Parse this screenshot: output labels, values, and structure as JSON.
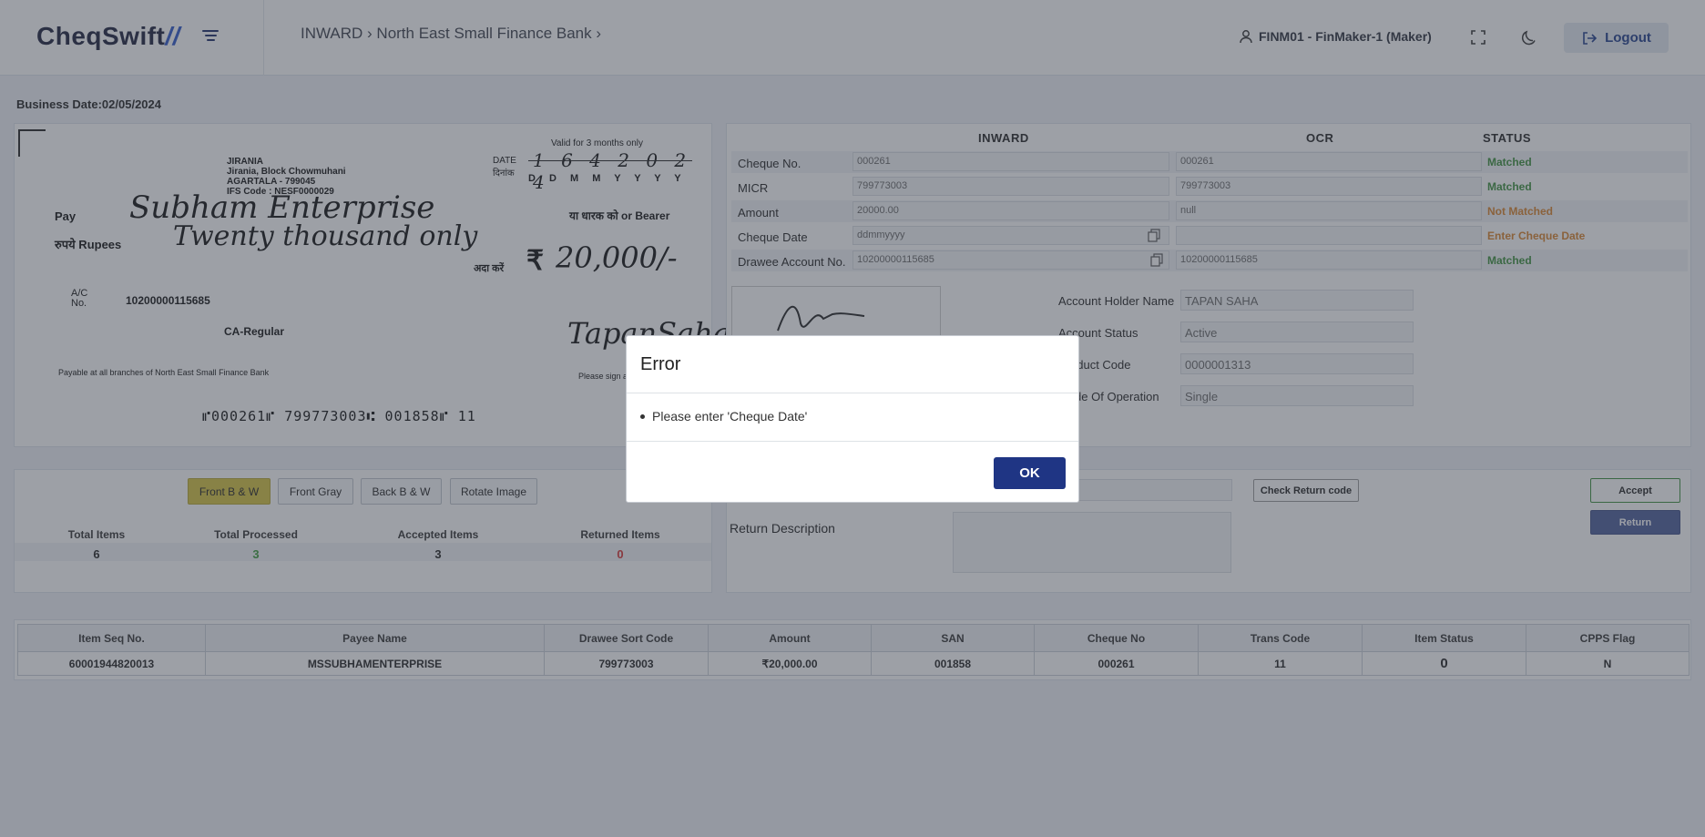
{
  "header": {
    "logo_text": "CheqSwift",
    "logo_slash": "//",
    "breadcrumb": "INWARD › North East Small Finance Bank ›",
    "user": "FINM01 - FinMaker-1 (Maker)",
    "logout_label": "Logout"
  },
  "business_date": "Business Date:02/05/2024",
  "cheque_image": {
    "valid_text": "Valid for 3 months only",
    "date_label": "DATE",
    "date_label_hi": "दिनांक",
    "date_handwritten": "1 6 4 2 0 2 4",
    "date_format": "D D M M Y Y Y Y",
    "drawer_name": "JIRANIA",
    "drawer_addr1": "Jirania, Block Chowmuhani",
    "drawer_addr2": "AGARTALA - 799045",
    "ifs_code": "IFS Code : NESF0000029",
    "pay_label": "Pay",
    "payee_hand": "Subham Enterprise",
    "or_bearer": "या धारक को or Bearer",
    "rupees_label": "रुपये Rupees",
    "amount_words_hand": "Twenty thousand only",
    "ada_kare": "अदा करें",
    "rupee_symbol": "₹",
    "amount_hand": "20,000/-",
    "ac_label": "A/C No.",
    "ac_no": "10200000115685",
    "ac_type": "CA-Regular",
    "sign_hand": "TapanSaha",
    "payable_text": "Payable at all branches of North East Small Finance Bank",
    "please_sign": "Please sign above",
    "micr_line": "⑈000261⑈ 799773003⑆ 001858⑈ 11"
  },
  "details": {
    "col_inward": "INWARD",
    "col_ocr": "OCR",
    "col_status": "STATUS",
    "rows": [
      {
        "label": "Cheque No.",
        "inward": "000261",
        "ocr": "000261",
        "status": "Matched"
      },
      {
        "label": "MICR",
        "inward": "799773003",
        "ocr": "799773003",
        "status": "Matched"
      },
      {
        "label": "Amount",
        "inward": "20000.00",
        "ocr": "null",
        "status": "Not Matched"
      },
      {
        "label": "Cheque Date",
        "inward": "ddmmyyyy",
        "ocr": "",
        "status": "Enter Cheque Date"
      },
      {
        "label": "Drawee Account No.",
        "inward": "10200000115685",
        "ocr": "10200000115685",
        "status": "Matched"
      }
    ],
    "status_colors": {
      "matched": "#3a8f3a",
      "warn": "#d9822b"
    },
    "account": {
      "holder_label": "Account Holder Name",
      "holder": "TAPAN SAHA",
      "status_label": "Account Status",
      "status": "Active",
      "product_label": "Product Code",
      "product": "0000001313",
      "mode_label": "Mode Of Operation",
      "mode": "Single"
    }
  },
  "image_buttons": [
    "Front B & W",
    "Front Gray",
    "Back B & W",
    "Rotate Image"
  ],
  "stats": {
    "total_items_label": "Total Items",
    "total_items": "6",
    "total_processed_label": "Total Processed",
    "total_processed": "3",
    "accepted_label": "Accepted Items",
    "accepted": "3",
    "returned_label": "Returned Items",
    "returned": "0"
  },
  "return_panel": {
    "check_return_code": "Check Return code",
    "accept": "Accept",
    "return": "Return",
    "return_description_label": "Return Description"
  },
  "table": {
    "headers": [
      "Item Seq No.",
      "Payee Name",
      "Drawee Sort Code",
      "Amount",
      "SAN",
      "Cheque No",
      "Trans Code",
      "Item Status",
      "CPPS Flag"
    ],
    "rows": [
      [
        "60001944820013",
        "MSSUBHAMENTERPRISE",
        "799773003",
        "₹20,000.00",
        "001858",
        "000261",
        "11",
        "0",
        "N"
      ]
    ]
  },
  "modal": {
    "title": "Error",
    "message": "Please enter 'Cheque Date'",
    "ok_label": "OK"
  }
}
